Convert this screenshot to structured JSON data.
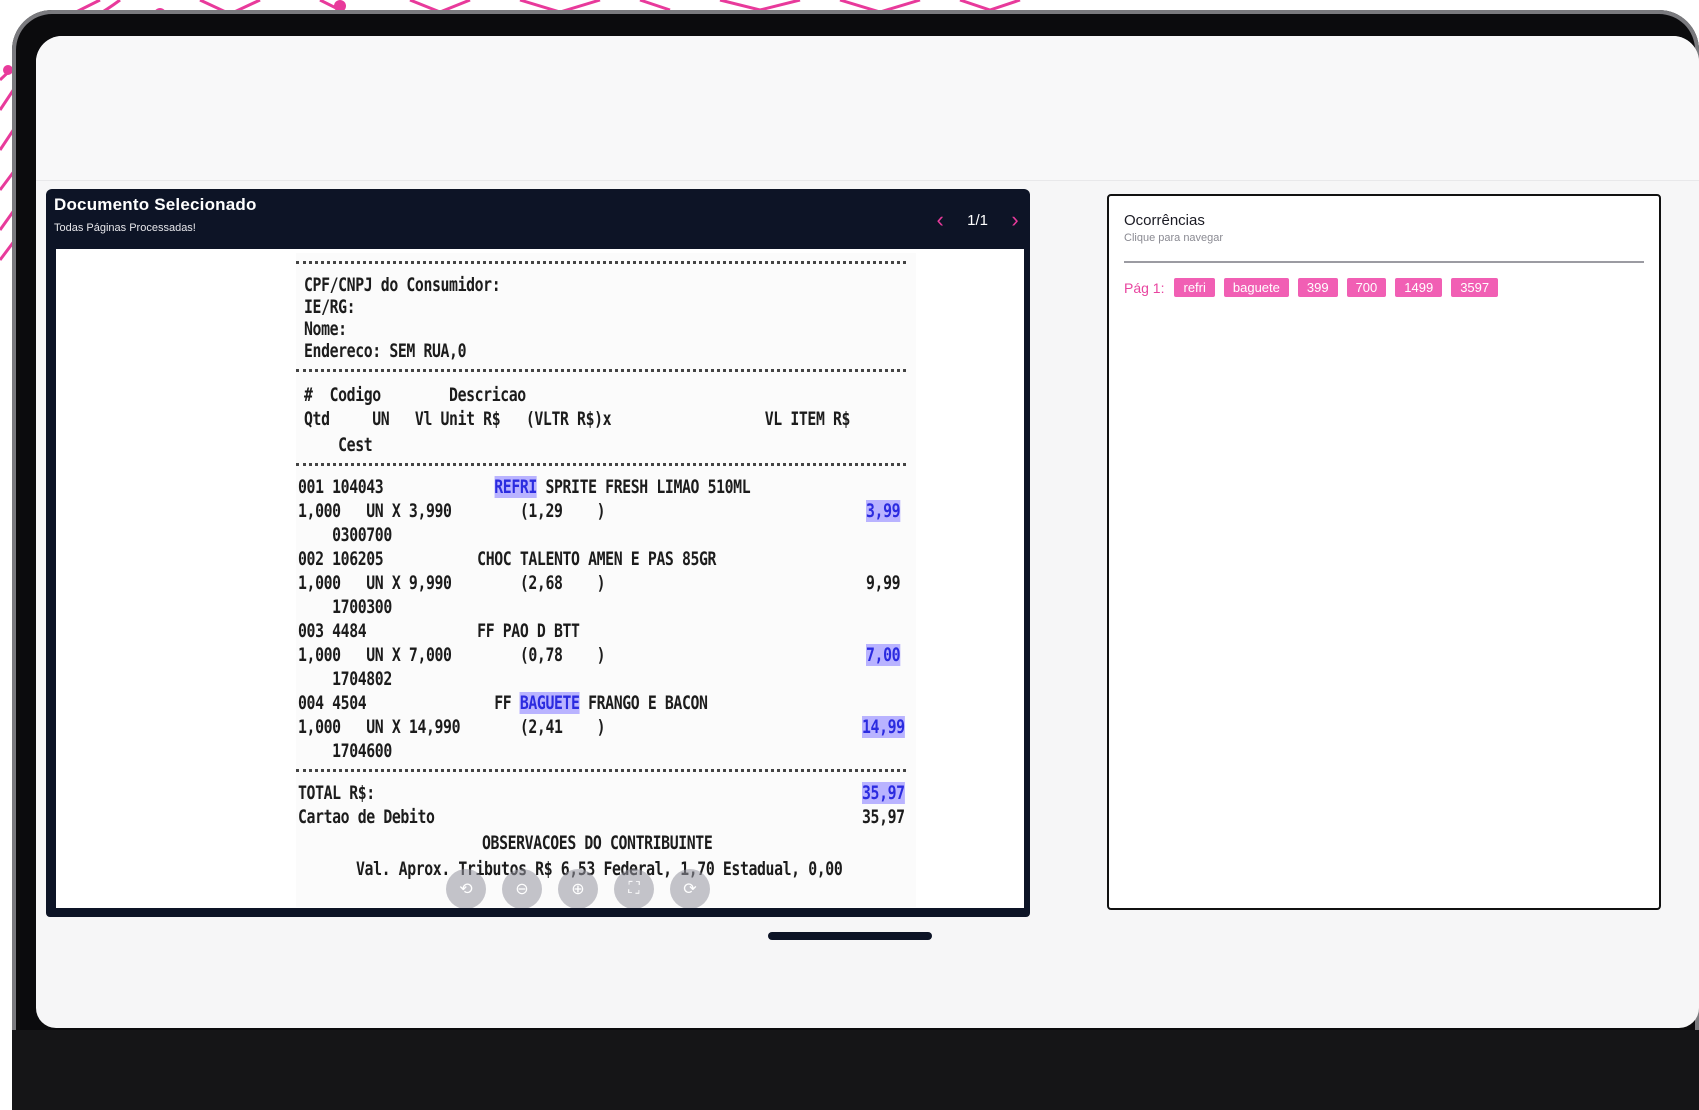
{
  "document": {
    "title": "Documento Selecionado",
    "subtitle": "Todas Páginas Processadas!",
    "page_indicator": "1/1"
  },
  "receipt": {
    "lines": [
      "CPF/CNPJ do Consumidor:",
      "IE/RG:",
      "Nome:",
      "Endereco: SEM RUA,0",
      "#  Codigo        Descricao",
      "Qtd     UN   Vl Unit R$   (VLTR R$)x                  VL ITEM R$",
      "    Cest",
      "001 104043           SPRITE FRESH LIMAO 510ML",
      "1,000   UN X 3,990        (1,29    )",
      "    0300700",
      "002 106205           CHOC TALENTO AMEN E PAS 85GR",
      "1,000   UN X 9,990        (2,68    )",
      "    1700300",
      "003 4484             FF PAO D BTT",
      "1,000   UN X 7,000        (0,78    )",
      "    1704802",
      "004 4504             FF       FRANGO E BACON",
      "1,000   UN X 14,990       (2,41    )",
      "    1704600",
      "TOTAL R$:",
      "Cartao de Debito",
      "OBSERVACOES DO CONTRIBUINTE",
      "Val. Aprox. Tributos R$ 6,53 Federal, 1,70 Estadual, 0,00"
    ],
    "highlights": {
      "refri": "REFRI",
      "baguete": "BAGUETE",
      "v1": "3,99",
      "v2": "9,99",
      "v3": "7,00",
      "v4": "14,99",
      "total": "35,97",
      "total2": "35,97"
    }
  },
  "tools": {
    "icons": [
      "reset-icon",
      "zoom-out-icon",
      "zoom-in-icon",
      "fit-icon",
      "rotate-icon"
    ]
  },
  "occurrences": {
    "title": "Ocorrências",
    "hint": "Clique para navegar",
    "page_label": "Pág 1:",
    "chips": [
      "refri",
      "baguete",
      "399",
      "700",
      "1499",
      "3597"
    ]
  },
  "colors": {
    "accent": "#e83a9b",
    "chip": "#f15fb4",
    "header": "#0d1426",
    "highlight": "#b9b3ff"
  }
}
